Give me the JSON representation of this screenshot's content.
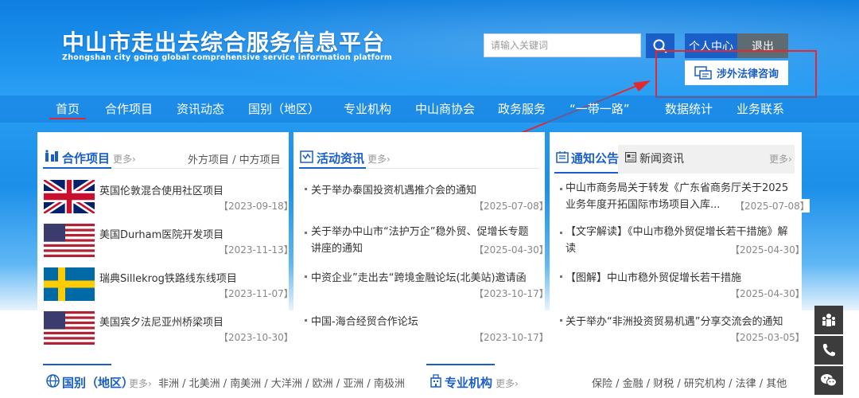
{
  "header": {
    "logo_cn": "中山市走出去综合服务信息平台",
    "logo_en": "Zhongshan city going global comprehensive service information platform",
    "search_placeholder": "请输入关键词",
    "personal_center": "个人中心",
    "logout": "退出",
    "legal_consult": "涉外法律咨询"
  },
  "nav": {
    "items": [
      "首页",
      "合作项目",
      "资讯动态",
      "国别（地区）",
      "专业机构",
      "中山商协会",
      "政务服务",
      "“一带一路”",
      "数据统计",
      "业务联系"
    ],
    "active": "首页"
  },
  "cooperation": {
    "title": "合作项目",
    "more": "更多›",
    "tabs": "外方项目 / 中方项目",
    "items": [
      {
        "flag": "uk-flag",
        "text": "英国伦敦混合使用社区项目",
        "date": "【2023-09-18】"
      },
      {
        "flag": "us-flag",
        "text": "美国Durham医院开发项目",
        "date": "【2023-11-13】"
      },
      {
        "flag": "sweden-flag",
        "text": "瑞典Sillekrog铁路线东线项目",
        "date": "【2023-11-07】"
      },
      {
        "flag": "us-flag",
        "text": "美国宾夕法尼亚州桥梁项目",
        "date": "【2023-10-30】"
      }
    ]
  },
  "activities": {
    "title": "活动资讯",
    "more": "更多›",
    "items": [
      {
        "text": "关于举办泰国投资机遇推介会的通知",
        "date": "【2025-07-08】"
      },
      {
        "text": "关于举办中山市“法护万企”稳外贸、促增长专题讲座的通知",
        "date": "【2025-04-30】"
      },
      {
        "text": "中资企业”走出去“跨境金融论坛(北美站)邀请函",
        "date": "【2023-10-17】"
      },
      {
        "text": "中国-海合经贸合作论坛",
        "date": "【2023-10-17】"
      }
    ]
  },
  "notices": {
    "title": "通知公告",
    "tab2": "新闻资讯",
    "more": "更多›",
    "items": [
      {
        "text": "中山市商务局关于转发《广东省商务厅关于2025业务年度开拓国际市场项目入库...",
        "date": "【2025-07-08】"
      },
      {
        "text": "【文字解读】《中山市稳外贸促增长若干措施》解读",
        "date": "【2025-04-30】"
      },
      {
        "text": "【图解】中山市稳外贸促增长若干措施",
        "date": "【2025-04-30】"
      },
      {
        "text": "关于举办“非洲投资贸易机遇”分享交流会的通知",
        "date": "【2025-03-05】"
      }
    ]
  },
  "regions": {
    "title": "国别（地区）",
    "more": "更多›",
    "list": "非洲 / 北美洲 / 南美洲 / 大洋洲 / 欧洲 / 亚洲 / 南极洲"
  },
  "institutions": {
    "title": "专业机构",
    "more": "更多›",
    "list": "保险 / 金融 / 财税 / 研究机构 / 法律 / 其他"
  },
  "colors": {
    "primary": "#1a5ec8",
    "accent_red": "#e4282b",
    "banner": "#1f95f0"
  }
}
